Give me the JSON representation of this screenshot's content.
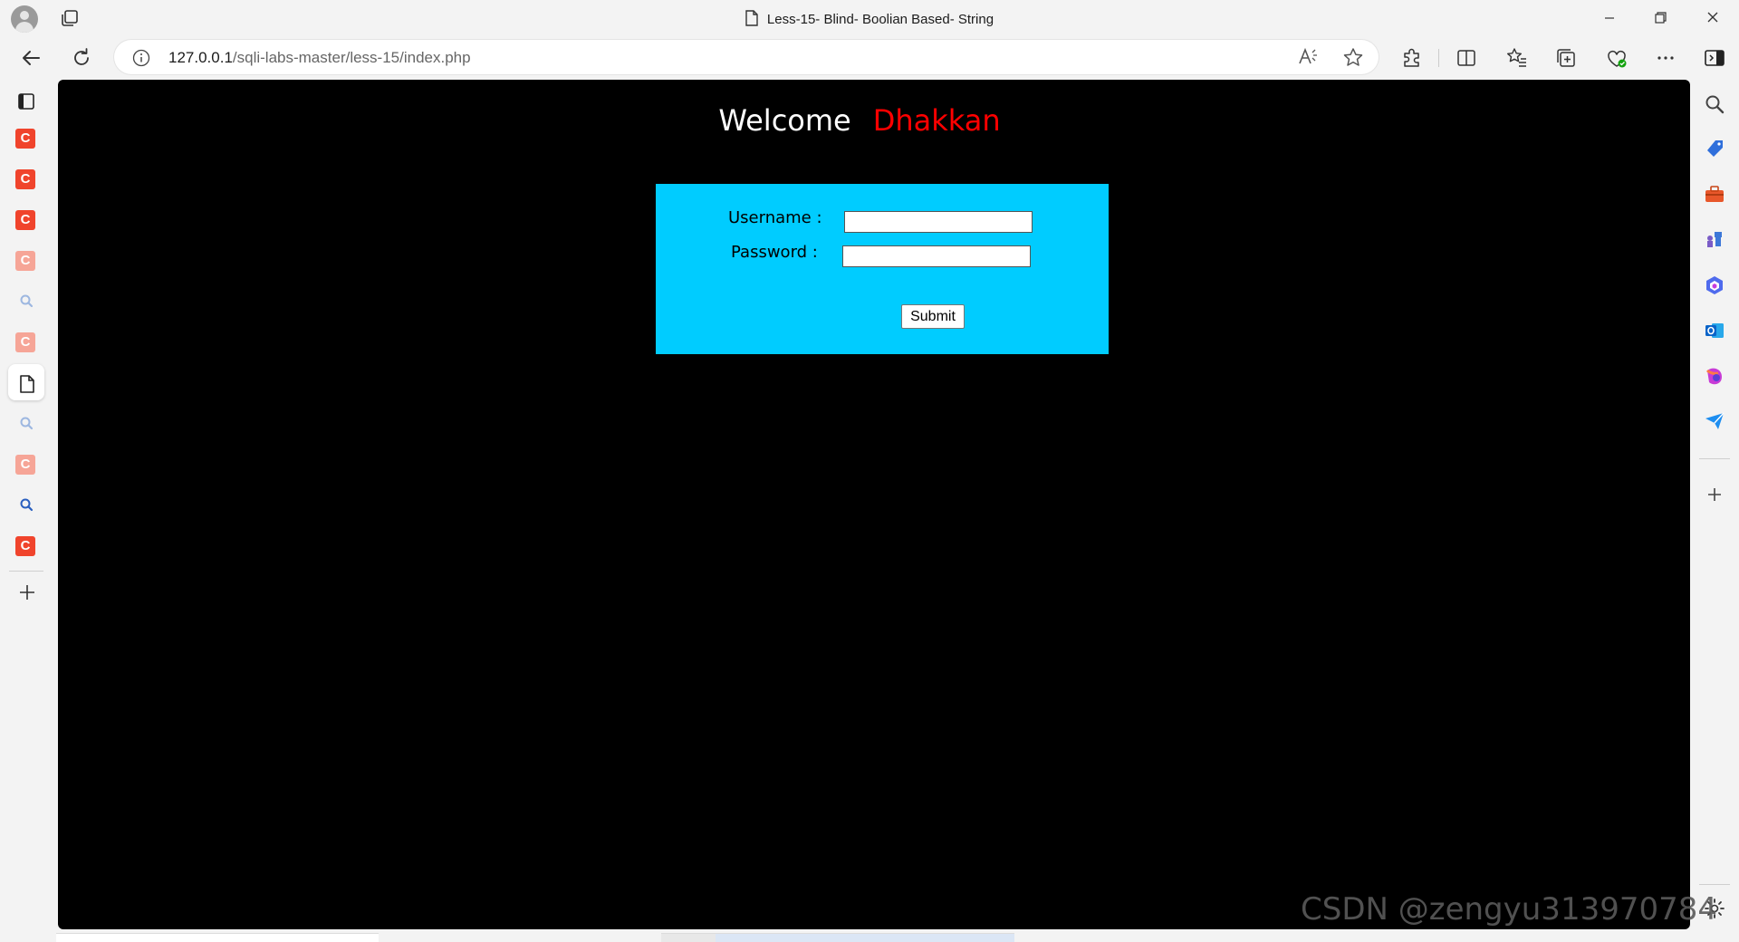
{
  "window": {
    "title": "Less-15- Blind- Boolian Based- String"
  },
  "address_bar": {
    "url_host": "127.0.0.1",
    "url_path": "/sqli-labs-master/less-15/index.php"
  },
  "page": {
    "welcome_text": "Welcome",
    "welcome_name": "Dhakkan",
    "username_label": "Username :",
    "password_label": "Password :",
    "username_value": "",
    "password_value": "",
    "submit_label": "Submit"
  },
  "vertical_tabs": [
    {
      "icon": "csdn-c-icon",
      "letter": "C"
    },
    {
      "icon": "csdn-c-icon",
      "letter": "C"
    },
    {
      "icon": "csdn-c-icon",
      "letter": "C"
    },
    {
      "icon": "csdn-c-icon",
      "letter": "C"
    },
    {
      "icon": "search-icon",
      "letter": ""
    },
    {
      "icon": "csdn-c-icon",
      "letter": "C"
    },
    {
      "icon": "document-icon",
      "letter": ""
    },
    {
      "icon": "search-icon",
      "letter": ""
    },
    {
      "icon": "csdn-c-icon",
      "letter": "C"
    },
    {
      "icon": "search-icon",
      "letter": ""
    },
    {
      "icon": "csdn-c-icon",
      "letter": "C"
    }
  ],
  "watermark": "CSDN @zengyu313970784",
  "colors": {
    "page_background": "#000000",
    "login_box": "#00ccff",
    "name_red": "#ff0000",
    "csdn_red": "#f0442c"
  }
}
